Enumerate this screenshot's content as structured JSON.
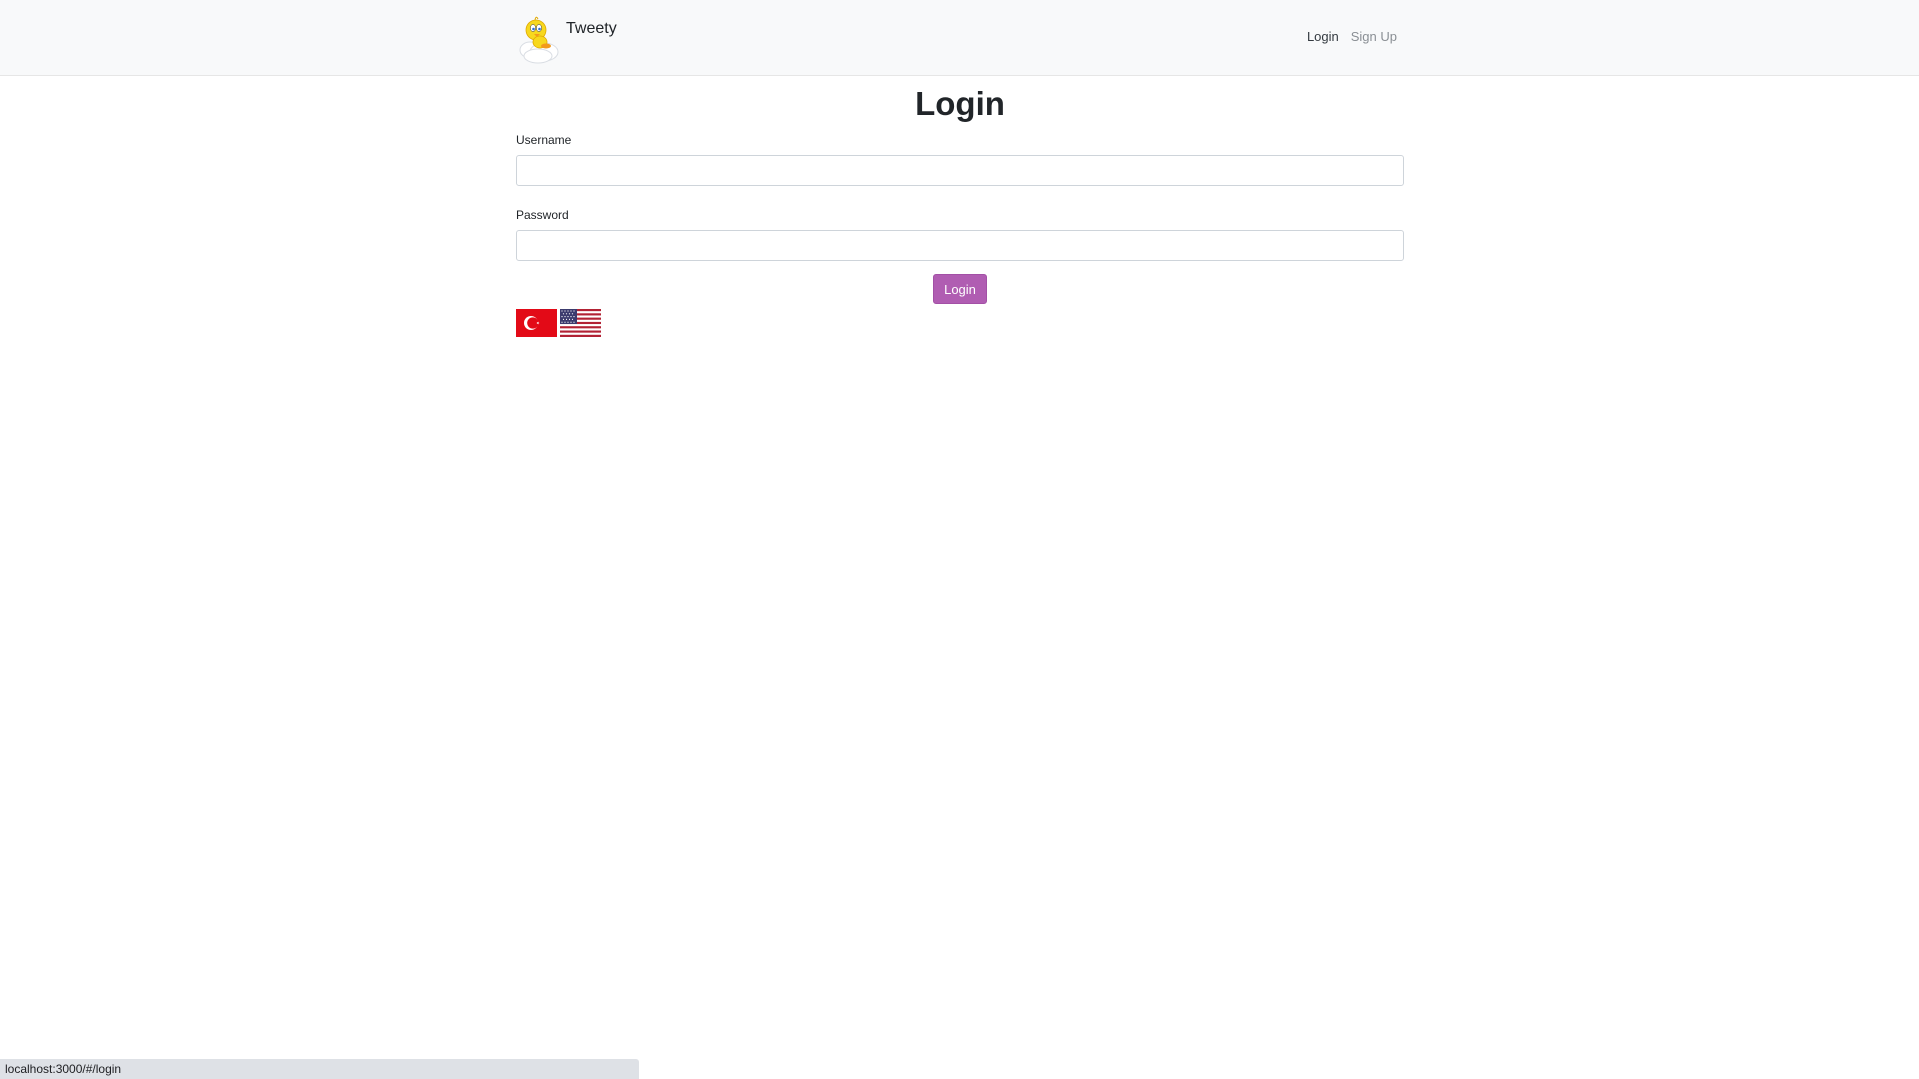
{
  "navbar": {
    "brand": "Tweety",
    "links": [
      {
        "label": "Login"
      },
      {
        "label": "Sign Up"
      }
    ]
  },
  "login_form": {
    "title": "Login",
    "username_label": "Username",
    "username_value": "",
    "password_label": "Password",
    "password_value": "",
    "submit_label": "Login"
  },
  "languages": [
    {
      "flag": "turkey-flag-icon"
    },
    {
      "flag": "usa-flag-icon"
    }
  ],
  "colors": {
    "primary": "#b05db2",
    "navbar_bg": "#f8f9fa",
    "turkey_red": "#e30a17",
    "usa_red": "#b22234",
    "usa_blue": "#3c3b6e"
  },
  "status_bar": {
    "url": "localhost:3000/#/login"
  }
}
